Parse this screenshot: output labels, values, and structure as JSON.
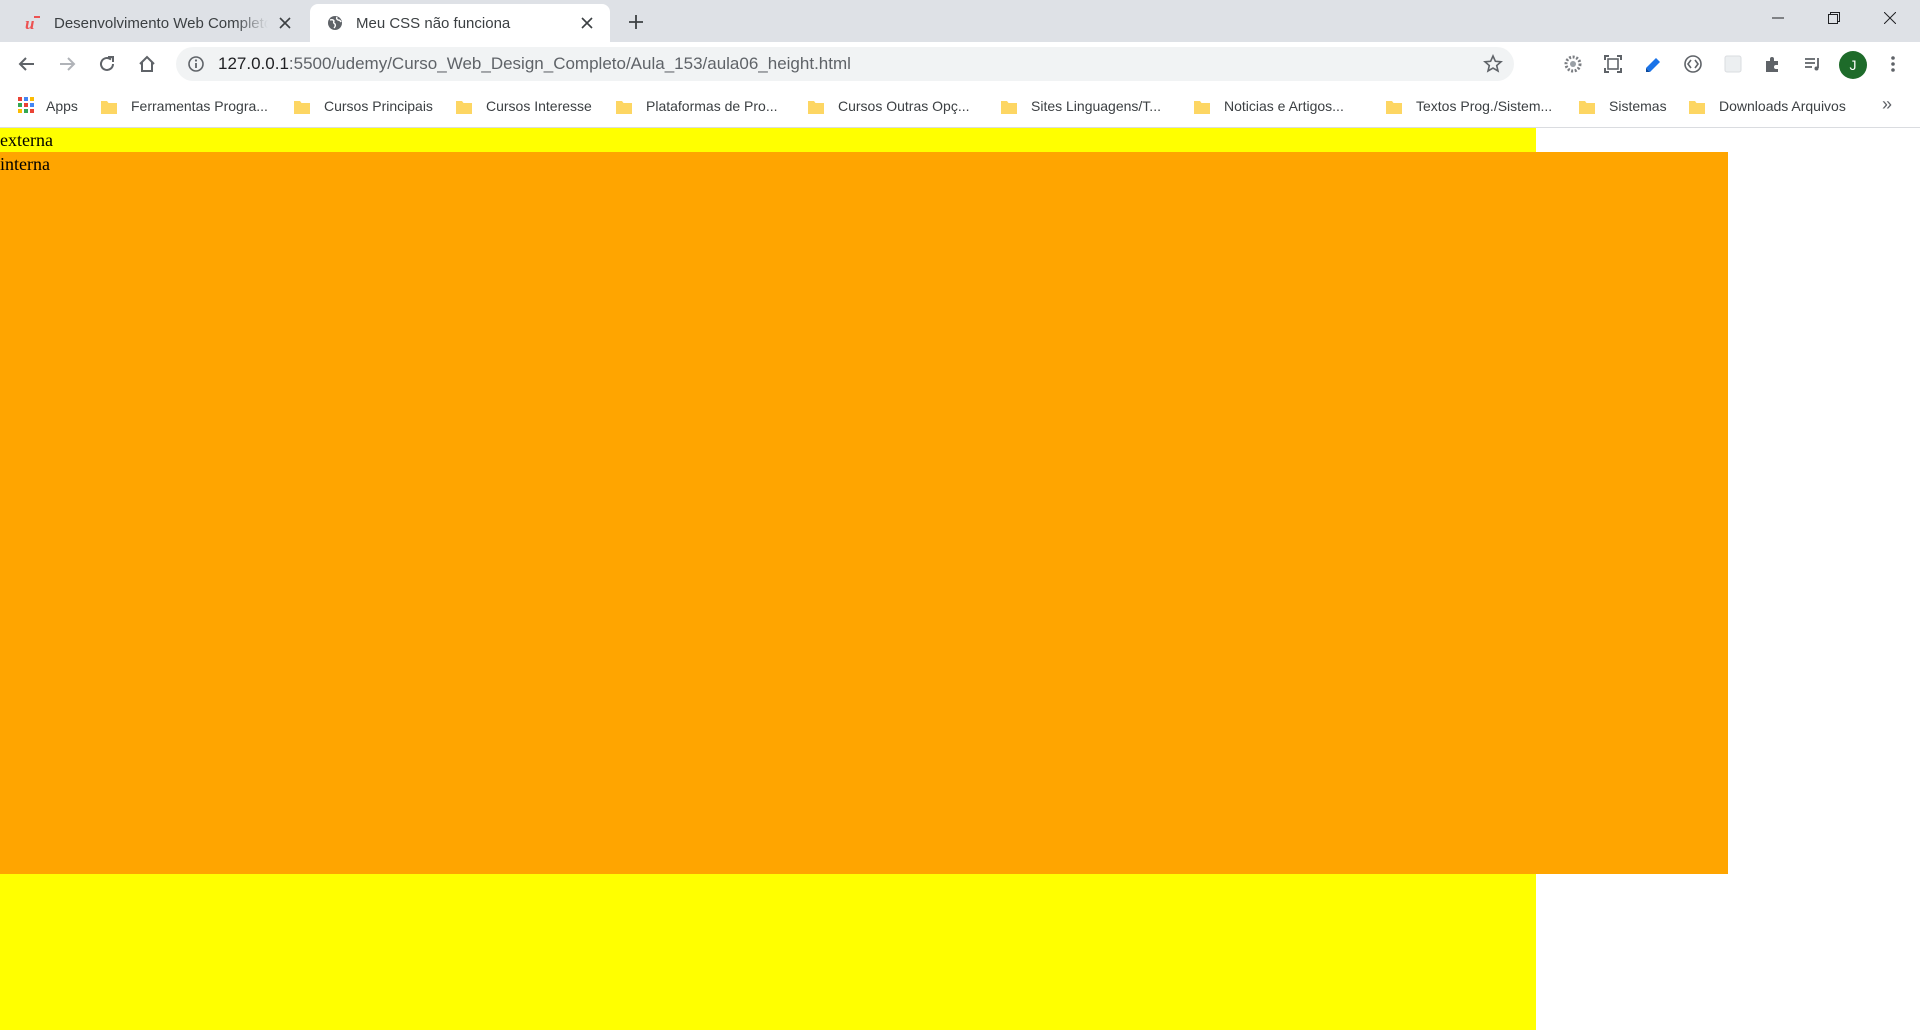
{
  "browser": {
    "tabs": [
      {
        "title": "Desenvolvimento Web Completo",
        "active": false,
        "icon": "udemy-icon"
      },
      {
        "title": "Meu CSS não funciona",
        "active": true,
        "icon": "globe-icon"
      }
    ],
    "address": {
      "host": "127.0.0.1",
      "path": ":5500/udemy/Curso_Web_Design_Completo/Aula_153/aula06_height.html"
    },
    "profile_initial": "J",
    "bookmarks": [
      "Apps",
      "Ferramentas Progra...",
      "Cursos Principais",
      "Cursos Interesse",
      "Plataformas de Pro...",
      "Cursos Outras Opç...",
      "Sites Linguagens/T...",
      "Noticias e Artigos...",
      "Textos Prog./Sistem...",
      "Sistemas",
      "Downloads Arquivos"
    ],
    "bookmarks_overflow": "»"
  },
  "page": {
    "externa": {
      "label": "externa",
      "color": "#ffff00"
    },
    "interna": {
      "label": "interna",
      "color": "#ffa500"
    }
  },
  "colors": {
    "tabstrip": "#dee1e6",
    "omnibox": "#f1f3f4",
    "avatar": "#1e6b2a",
    "folder": "#fdd663"
  }
}
